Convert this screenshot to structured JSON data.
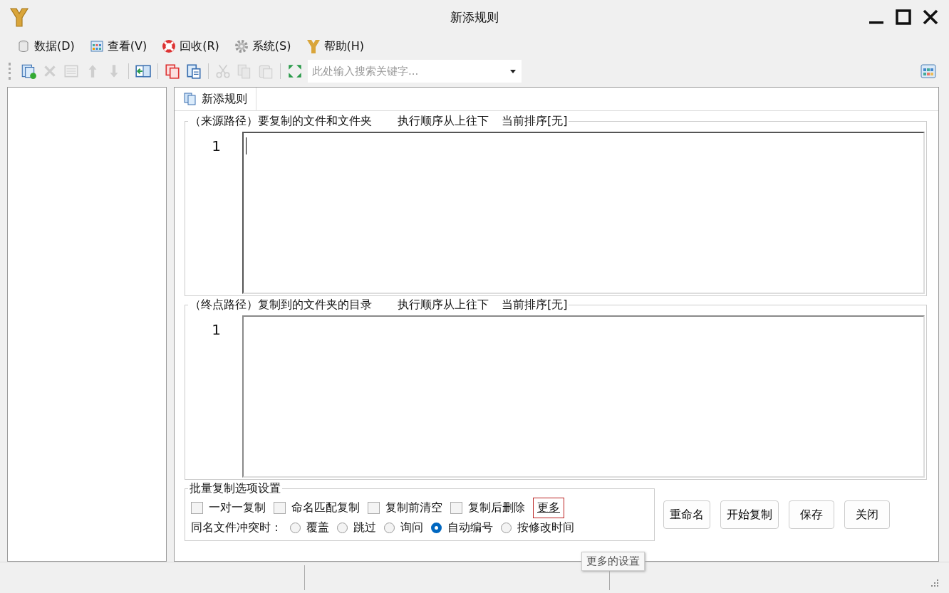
{
  "window": {
    "title": "新添规则"
  },
  "menu": [
    {
      "label": "数据(D)"
    },
    {
      "label": "查看(V)"
    },
    {
      "label": "回收(R)"
    },
    {
      "label": "系统(S)"
    },
    {
      "label": "帮助(H)"
    }
  ],
  "toolbar": [
    {
      "disabled": false
    },
    {
      "disabled": true
    },
    {
      "disabled": true
    },
    {
      "disabled": true
    },
    {
      "disabled": true
    },
    {
      "disabled": false
    },
    {
      "disabled": false
    },
    {
      "disabled": false
    },
    {
      "disabled": true
    },
    {
      "disabled": true
    },
    {
      "disabled": true
    },
    {
      "disabled": false
    }
  ],
  "search": {
    "placeholder": "此处输入搜索关键字..."
  },
  "tabs": [
    {
      "label": "新添规则",
      "selected": true
    }
  ],
  "sections": [
    {
      "legend": "（来源路径）要复制的文件和文件夹",
      "order": "执行顺序从上往下",
      "sort": "当前排序[无]",
      "line_numbers": [
        "1"
      ],
      "focused": true
    },
    {
      "legend": "（终点路径）复制到的文件夹的目录",
      "order": "执行顺序从上往下",
      "sort": "当前排序[无]",
      "line_numbers": [
        "1"
      ],
      "focused": false
    }
  ],
  "options": {
    "legend": "批量复制选项设置",
    "checkboxes": [
      {
        "label": "一对一复制",
        "checked": false
      },
      {
        "label": "命名匹配复制",
        "checked": false
      },
      {
        "label": "复制前清空",
        "checked": false
      },
      {
        "label": "复制后删除",
        "checked": false
      }
    ],
    "more_link": {
      "label": "更多",
      "highlighted": true
    },
    "conflict_label": "同名文件冲突时：",
    "radios": [
      {
        "label": "覆盖",
        "selected": false
      },
      {
        "label": "跳过",
        "selected": false
      },
      {
        "label": "询问",
        "selected": false
      },
      {
        "label": "自动编号",
        "selected": true
      },
      {
        "label": "按修改时间",
        "selected": false
      }
    ]
  },
  "buttons": [
    "重命名",
    "开始复制",
    "保存",
    "关闭"
  ],
  "tooltip": "更多的设置"
}
